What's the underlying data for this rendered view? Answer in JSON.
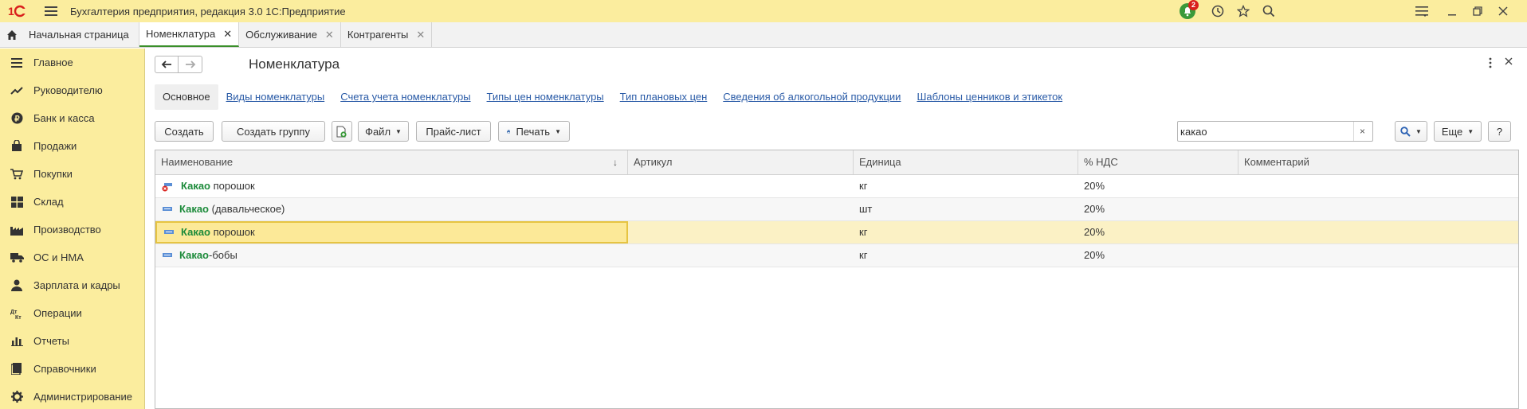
{
  "app": {
    "title": "Бухгалтерия предприятия, редакция 3.0 1С:Предприятие",
    "logo_icon": "1c-logo-icon",
    "notification_count": "2"
  },
  "tabs": [
    {
      "label": "Начальная страница",
      "icon": "home-icon",
      "active": false
    },
    {
      "label": "Номенклатура",
      "active": true
    },
    {
      "label": "Обслуживание",
      "active": false
    },
    {
      "label": "Контрагенты",
      "active": false
    }
  ],
  "sidebar": {
    "items": [
      {
        "label": "Главное",
        "icon": "menu-lines-icon"
      },
      {
        "label": "Руководителю",
        "icon": "trend-icon"
      },
      {
        "label": "Банк и касса",
        "icon": "ruble-coin-icon"
      },
      {
        "label": "Продажи",
        "icon": "shopping-bag-icon"
      },
      {
        "label": "Покупки",
        "icon": "cart-icon"
      },
      {
        "label": "Склад",
        "icon": "warehouse-grid-icon"
      },
      {
        "label": "Производство",
        "icon": "factory-icon"
      },
      {
        "label": "ОС и НМА",
        "icon": "truck-icon"
      },
      {
        "label": "Зарплата и кадры",
        "icon": "person-icon"
      },
      {
        "label": "Операции",
        "icon": "debit-credit-icon"
      },
      {
        "label": "Отчеты",
        "icon": "bar-chart-icon"
      },
      {
        "label": "Справочники",
        "icon": "book-icon"
      },
      {
        "label": "Администрирование",
        "icon": "gear-icon"
      }
    ]
  },
  "page": {
    "title": "Номенклатура"
  },
  "subnav": [
    "Основное",
    "Виды номенклатуры",
    "Счета учета номенклатуры",
    "Типы цен номенклатуры",
    "Тип плановых цен",
    "Сведения об алкогольной продукции",
    "Шаблоны ценников и этикеток"
  ],
  "toolbar": {
    "create": "Создать",
    "create_group": "Создать группу",
    "file": "Файл",
    "price_list": "Прайс-лист",
    "print": "Печать",
    "search_value": "какао",
    "search_clear": "×",
    "more": "Еще",
    "help": "?"
  },
  "table": {
    "columns": [
      "Наименование",
      "Артикул",
      "Единица",
      "% НДС",
      "Комментарий"
    ],
    "sort_indicator": "↓",
    "rows": [
      {
        "match": "Какао",
        "rest": " порошок",
        "article": "",
        "unit": "кг",
        "vat": "20%",
        "comment": "",
        "marked_for_deletion": true
      },
      {
        "match": "Какао",
        "rest": " (давальческое)",
        "article": "",
        "unit": "шт",
        "vat": "20%",
        "comment": "",
        "marked_for_deletion": false
      },
      {
        "match": "Какао",
        "rest": " порошок",
        "article": "",
        "unit": "кг",
        "vat": "20%",
        "comment": "",
        "marked_for_deletion": false,
        "selected": true
      },
      {
        "match": "Какао",
        "rest": "-бобы",
        "article": "",
        "unit": "кг",
        "vat": "20%",
        "comment": "",
        "marked_for_deletion": false
      }
    ]
  },
  "colors": {
    "accent_yellow": "#fbed9e",
    "match_green": "#1d8b3b",
    "link_blue": "#2a5ba7",
    "selected_row": "#fbf1c5"
  }
}
